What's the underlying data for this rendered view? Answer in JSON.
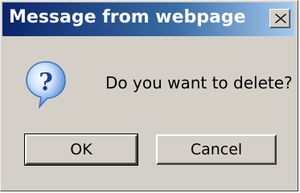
{
  "dialog": {
    "title": "Message from webpage",
    "message": "Do you want to delete?",
    "icon": "question-icon",
    "buttons": {
      "ok_label": "OK",
      "cancel_label": "Cancel"
    },
    "close_icon": "close-icon",
    "colors": {
      "title_bar_start": "#0a246a",
      "title_bar_end": "#a6caf0",
      "dialog_bg": "#d4d0c8",
      "icon_bubble": "#4a86d8"
    }
  }
}
